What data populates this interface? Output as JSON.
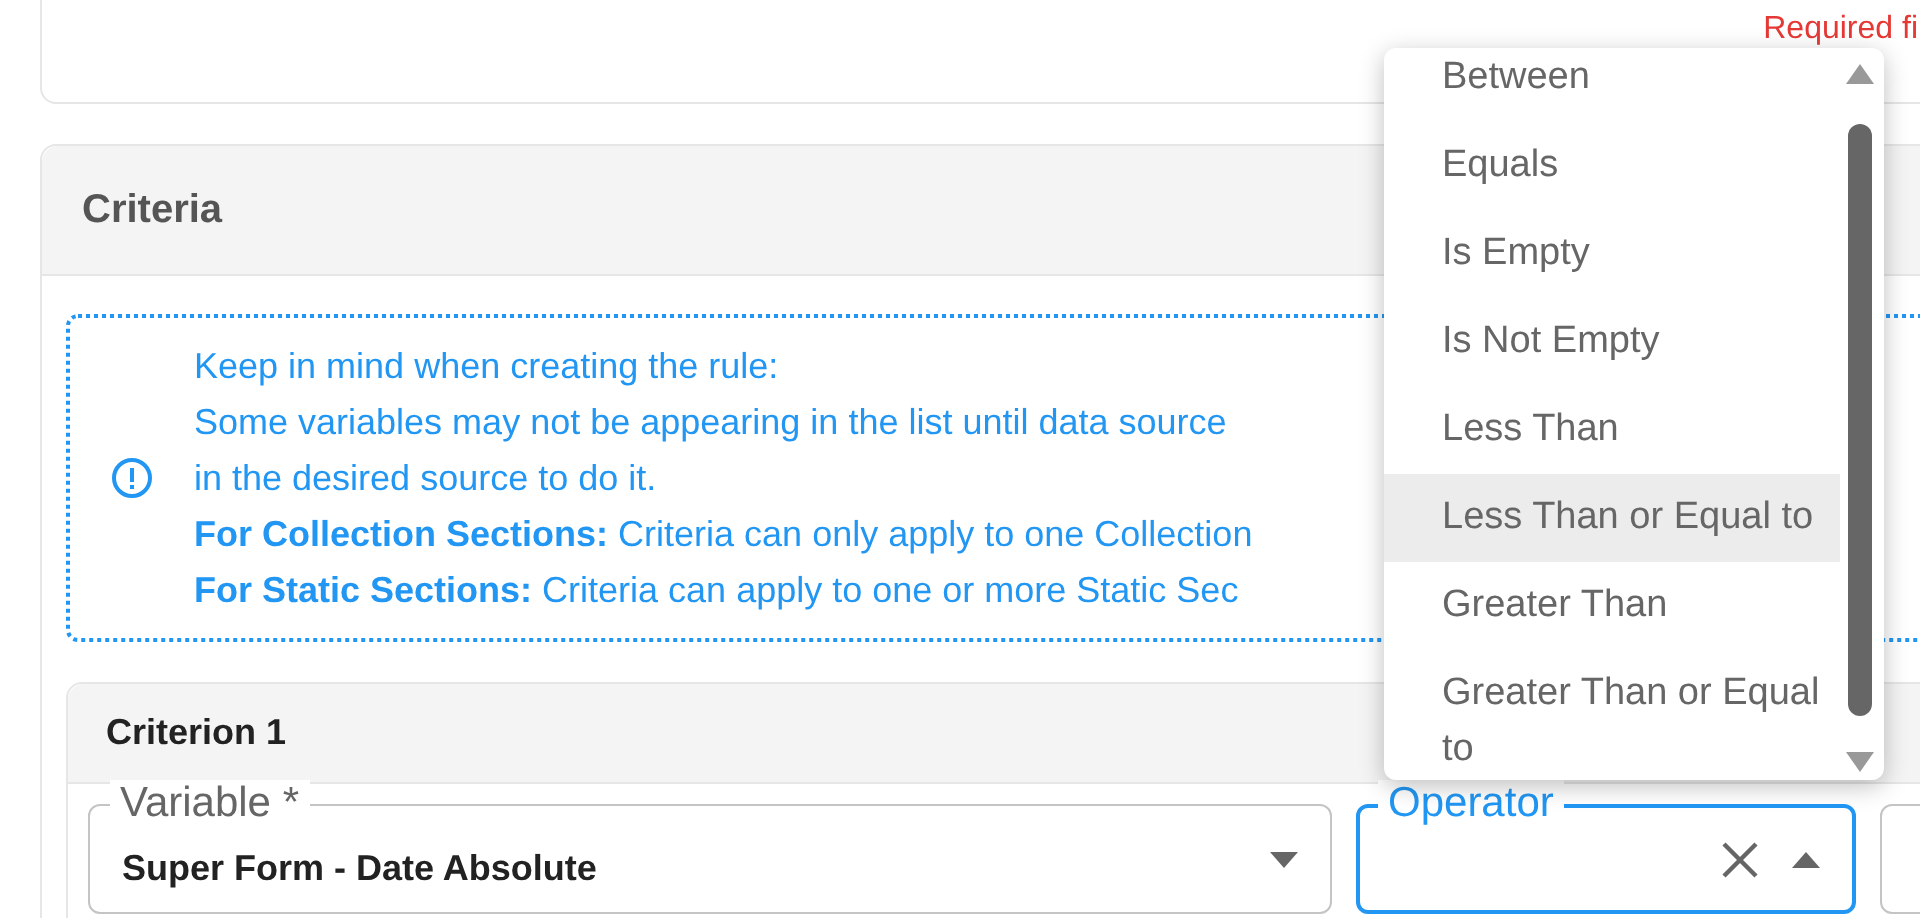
{
  "top_card": {
    "required_note": "Required fi"
  },
  "criteria": {
    "title": "Criteria",
    "info": {
      "lines": [
        "Keep in mind when creating the rule:",
        "Some variables may not be appearing in the list until data source",
        "in the desired source to do it.",
        "**For Collection Sections:**  Criteria can only apply to one Collection",
        "**For Static Sections:**  Criteria can apply to one or more Static Sec"
      ]
    },
    "criterion": {
      "title": "Criterion 1",
      "fields": [
        {
          "kind": "select",
          "label": "Variable *",
          "value": "Super Form - Date Absolute",
          "focused": false
        },
        {
          "kind": "select",
          "label": "Operator",
          "focused": true,
          "clearable": true
        },
        {
          "kind": "stub"
        }
      ]
    }
  },
  "operator_menu": {
    "options": [
      {
        "label": "Between",
        "highlighted": false
      },
      {
        "label": "Equals",
        "highlighted": false
      },
      {
        "label": "Is Empty",
        "highlighted": false
      },
      {
        "label": "Is Not Empty",
        "highlighted": false
      },
      {
        "label": "Less Than",
        "highlighted": false
      },
      {
        "label": "Less Than or Equal to",
        "highlighted": true
      },
      {
        "label": "Greater Than",
        "highlighted": false
      },
      {
        "label": "Greater Than or Equal to",
        "highlighted": false
      }
    ]
  }
}
